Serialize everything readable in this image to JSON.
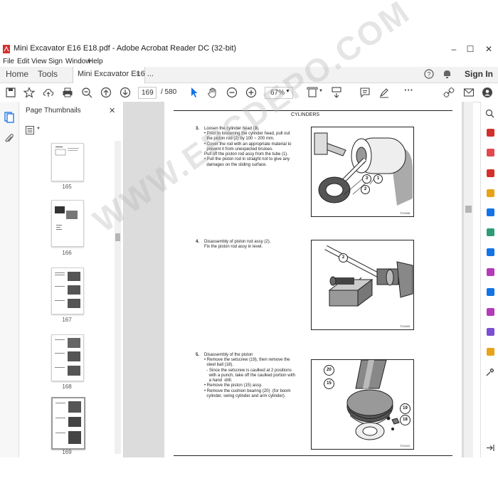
{
  "window": {
    "title": "Mini Excavator E16 E18.pdf - Adobe Acrobat Reader DC (32-bit)",
    "minimize": "–",
    "maximize": "☐",
    "close": "✕"
  },
  "menu": [
    "File",
    "Edit",
    "View",
    "Sign",
    "Window",
    "Help"
  ],
  "tabs": {
    "home": "Home",
    "tools": "Tools",
    "document": "Mini Excavator E16 ...",
    "close": "×",
    "sign_in": "Sign In"
  },
  "toolbar": {
    "page_current": "169",
    "page_total": "/ 580",
    "zoom": "67%"
  },
  "thumbnails": {
    "title": "Page Thumbnails",
    "close": "✕",
    "pages": [
      "165",
      "166",
      "167",
      "168",
      "169"
    ]
  },
  "page": {
    "header": "CYLINDERS",
    "watermark": "WWW.EPCDEPO.COM",
    "step3": {
      "number": "3.",
      "title_a": "Loosen the cylinder head (",
      "title_b": "3",
      "title_c": ").",
      "lines": [
        "• Prior to loosening the cylinder head, pull out",
        "  the piston rod (2) by 100 ~ 200 mm.",
        "• Cover the rod with an appropriate material to",
        "  prevent it from unexpected bruises.",
        "Pull off the piston rod assy from the tube (1).",
        "• Pull the piston rod in straight not to give any",
        "  damages on the sliding surface."
      ],
      "callouts": [
        "3",
        "1",
        "2"
      ],
      "code": "TC0408"
    },
    "step4": {
      "number": "4.",
      "title": "Disassembly of piston rod assy (2).",
      "line": "Fix the piston rod assy in level.",
      "callouts": [
        "2"
      ],
      "code": "TC0409"
    },
    "step5": {
      "number": "5.",
      "title": "Disassembly of the piston",
      "lines": [
        "• Remove the setscrew (19), then remove the",
        "  steel ball (18).",
        "  - Since the setscrew is caulked at 2 positions",
        "    with a punch, take off the caulked portion with",
        "    a hand  drill.",
        "• Remove the piston (15) assy.",
        "• Remove the cushion bearing (20)  (for boom",
        "  cylinder, swing cylinder and arm cylinder)."
      ],
      "callouts": [
        "20",
        "15",
        "19",
        "18"
      ],
      "code": "TC0410"
    }
  },
  "colors": {
    "accent_blue": "#1473e6",
    "acrobat_red": "#d4302b",
    "toolbar_icon": "#444444"
  }
}
